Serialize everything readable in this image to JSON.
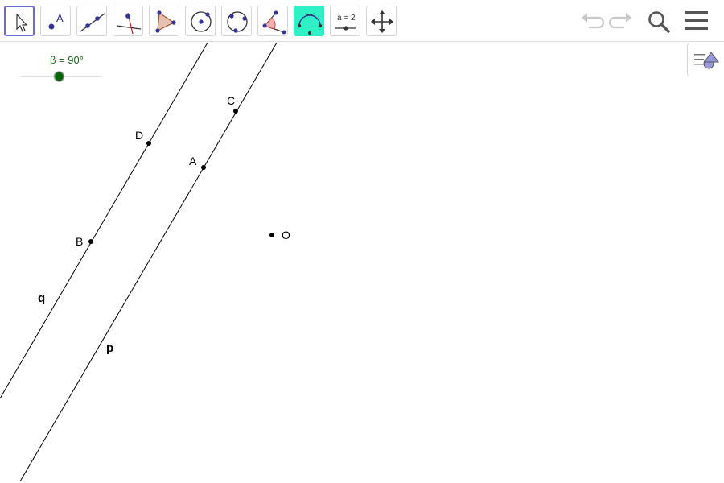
{
  "toolbar": {
    "tools": [
      {
        "name": "move-tool",
        "selected": true
      },
      {
        "name": "point-tool",
        "glyph": "A"
      },
      {
        "name": "line-tool"
      },
      {
        "name": "perpendicular-line-tool"
      },
      {
        "name": "polygon-tool"
      },
      {
        "name": "circle-center-point-tool"
      },
      {
        "name": "circle-three-points-tool"
      },
      {
        "name": "angle-tool"
      },
      {
        "name": "reflect-tool"
      },
      {
        "name": "slider-tool",
        "glyph": "a = 2"
      },
      {
        "name": "move-graphics-view-tool"
      }
    ],
    "right_icons": [
      "undo-icon",
      "redo-icon",
      "search-icon",
      "menu-icon"
    ]
  },
  "slider": {
    "label": "β = 90°",
    "fraction": 0.47,
    "color": "#006400"
  },
  "labels": {
    "point_c": "C",
    "point_d": "D",
    "point_a": "A",
    "point_b": "B",
    "point_o": "O",
    "line_q": "q",
    "line_p": "p"
  }
}
